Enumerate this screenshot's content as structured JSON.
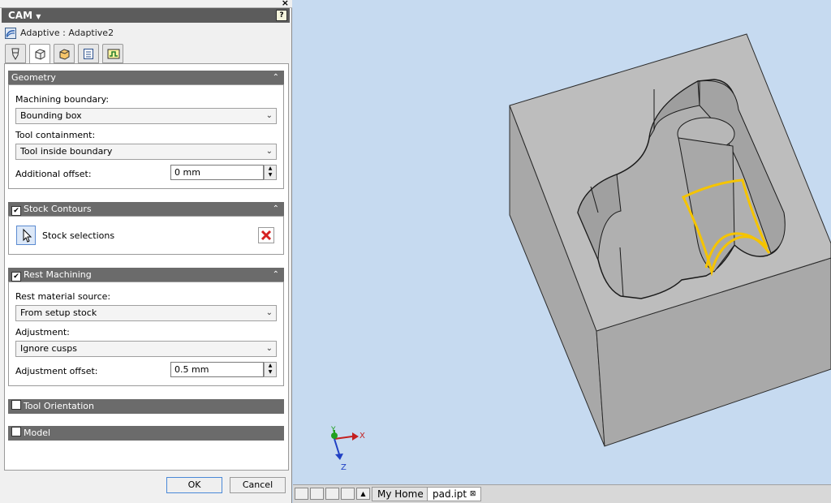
{
  "panel": {
    "title": "CAM",
    "help": "?",
    "operation": "Adaptive : Adaptive2",
    "close": "×",
    "tabs": [
      "tool-icon",
      "geometry-icon",
      "heights-icon",
      "passes-icon",
      "linking-icon"
    ],
    "active_tab": 1
  },
  "geometry": {
    "header": "Geometry",
    "boundary_label": "Machining boundary:",
    "boundary_value": "Bounding box",
    "containment_label": "Tool containment:",
    "containment_value": "Tool inside boundary",
    "offset_label": "Additional offset:",
    "offset_value": "0 mm"
  },
  "stock_contours": {
    "header": "Stock Contours",
    "checked": true,
    "selection_label": "Stock selections"
  },
  "rest_machining": {
    "header": "Rest Machining",
    "checked": true,
    "source_label": "Rest material source:",
    "source_value": "From setup stock",
    "adjustment_label": "Adjustment:",
    "adjustment_value": "Ignore cusps",
    "adj_offset_label": "Adjustment offset:",
    "adj_offset_value": "0.5 mm"
  },
  "tool_orientation": {
    "header": "Tool Orientation",
    "checked": false
  },
  "model": {
    "header": "Model",
    "checked": false
  },
  "buttons": {
    "ok": "OK",
    "cancel": "Cancel"
  },
  "viewport": {
    "triad": {
      "x": "X",
      "y": "Y",
      "z": "Z"
    },
    "highlight_color": "#f5c400"
  },
  "statusbar": {
    "tabs": [
      {
        "label": "My Home",
        "active": false
      },
      {
        "label": "pad.ipt",
        "active": true,
        "close": "⊠"
      }
    ]
  }
}
